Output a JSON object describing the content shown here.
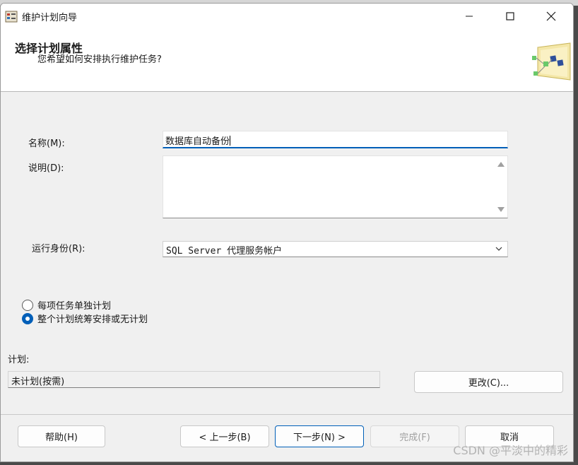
{
  "window": {
    "title": "维护计划向导"
  },
  "header": {
    "title": "选择计划属性",
    "subtitle": "您希望如何安排执行维护任务?"
  },
  "form": {
    "name_label": "名称(M):",
    "name_value": "数据库自动备份",
    "desc_label": "说明(D):",
    "desc_value": "",
    "runas_label": "运行身份(R):",
    "runas_value": "SQL Server 代理服务帐户"
  },
  "schedule_mode": {
    "options": [
      "每项任务单独计划",
      "整个计划统筹安排或无计划"
    ],
    "selected_index": 1
  },
  "schedule": {
    "label": "计划:",
    "value": "未计划(按需)",
    "change_button": "更改(C)..."
  },
  "footer": {
    "help": "帮助(H)",
    "back": "< 上一步(B)",
    "next": "下一步(N) >",
    "finish": "完成(F)",
    "cancel": "取消"
  },
  "watermark": "CSDN @平淡中的精彩",
  "colors": {
    "accent": "#005fb8",
    "background": "#f0f0f0",
    "header": "#ffffff"
  }
}
